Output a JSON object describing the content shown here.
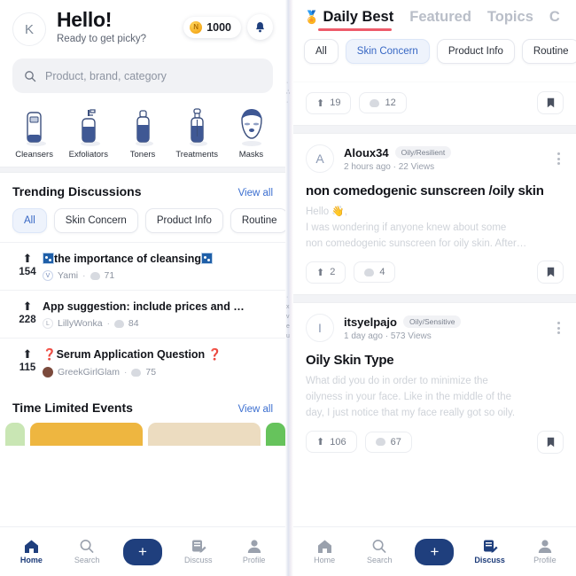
{
  "left": {
    "header": {
      "avatar_initial": "K",
      "greeting": "Hello!",
      "subtitle": "Ready to get picky?",
      "coin_value": "1000",
      "coin_icon": "coin-icon",
      "bell_icon": "bell-icon"
    },
    "search": {
      "placeholder": "Product, brand, category",
      "icon": "search-icon"
    },
    "categories": [
      {
        "label": "Cleansers",
        "icon": "tube-icon"
      },
      {
        "label": "Exfoliators",
        "icon": "pump-bottle-icon"
      },
      {
        "label": "Toners",
        "icon": "toner-bottle-icon"
      },
      {
        "label": "Treatments",
        "icon": "dropper-bottle-icon"
      },
      {
        "label": "Masks",
        "icon": "face-mask-icon"
      }
    ],
    "trending": {
      "title": "Trending Discussions",
      "view_all": "View all",
      "chips": [
        "All",
        "Skin Concern",
        "Product Info",
        "Routine"
      ],
      "selected_chip": "All",
      "items": [
        {
          "votes": "154",
          "title_prefix_emoji": "sparkle",
          "title": "the importance of cleansing",
          "title_suffix_emoji": "sparkle",
          "author": "Yami",
          "author_initial": "V",
          "comments": "71"
        },
        {
          "votes": "228",
          "title": "App suggestion: include prices and …",
          "author": "LillyWonka",
          "author_initial": "L",
          "comments": "84"
        },
        {
          "votes": "115",
          "title_prefix_emoji": "question",
          "title": "Serum Application Question",
          "title_suffix_emoji": "question",
          "author": "GreekGirlGlam",
          "author_initial": "",
          "comments": "75"
        }
      ]
    },
    "events": {
      "title": "Time Limited Events",
      "view_all": "View all"
    },
    "nav": {
      "items": [
        {
          "label": "Home",
          "icon": "home-icon"
        },
        {
          "label": "Search",
          "icon": "search-icon"
        },
        {
          "label": "",
          "icon": "plus-icon"
        },
        {
          "label": "Discuss",
          "icon": "discuss-icon"
        },
        {
          "label": "Profile",
          "icon": "profile-icon"
        }
      ],
      "active": "Home"
    }
  },
  "right": {
    "tabs": [
      {
        "label": "Daily Best",
        "icon": "medal-icon"
      },
      {
        "label": "Featured"
      },
      {
        "label": "Topics"
      },
      {
        "label": "C"
      }
    ],
    "active_tab": "Daily Best",
    "chips": [
      "All",
      "Skin Concern",
      "Product Info",
      "Routine"
    ],
    "selected_chip": "Skin Concern",
    "top_clipped_post": {
      "upvotes": "19",
      "comments": "12",
      "bookmark_icon": "bookmark-icon"
    },
    "posts": [
      {
        "avatar_initial": "A",
        "author": "Aloux34",
        "skin_tag": "Oily/Resilient",
        "meta": "2 hours ago  ·  22 Views",
        "title": "non comedogenic sunscreen /oily skin",
        "body_line1": "Hello",
        "body_emoji": "wave",
        "body_line1b": ",",
        "body_line2": "I was wondering if anyone knew about some",
        "body_line3": "non comedogenic sunscreen for oily skin. After…",
        "upvotes": "2",
        "comments": "4",
        "bookmark_icon": "bookmark-icon",
        "menu_icon": "kebab-menu-icon"
      },
      {
        "avatar_initial": "I",
        "author": "itsyelpajo",
        "skin_tag": "Oily/Sensitive",
        "meta": "1 day ago  ·  573 Views",
        "title": "Oily Skin Type",
        "body_line1": "What did you do in order to minimize the",
        "body_line2": "oilyness in your face. Like in the middle of the",
        "body_line3": "day, I just notice that my face really got so oily.",
        "upvotes": "106",
        "comments": "67",
        "bookmark_icon": "bookmark-icon",
        "menu_icon": "kebab-menu-icon"
      }
    ],
    "nav": {
      "items": [
        {
          "label": "Home",
          "icon": "home-icon"
        },
        {
          "label": "Search",
          "icon": "search-icon"
        },
        {
          "label": "",
          "icon": "plus-icon"
        },
        {
          "label": "Discuss",
          "icon": "discuss-icon"
        },
        {
          "label": "Profile",
          "icon": "profile-icon"
        }
      ],
      "active": "Discuss"
    }
  },
  "colors": {
    "brand_navy": "#1f3f7d",
    "accent_red": "#ee5b6a",
    "link_blue": "#3c6fd0",
    "chip_selected_bg": "#eef3fc",
    "coin_gold": "#f5ab1e"
  }
}
